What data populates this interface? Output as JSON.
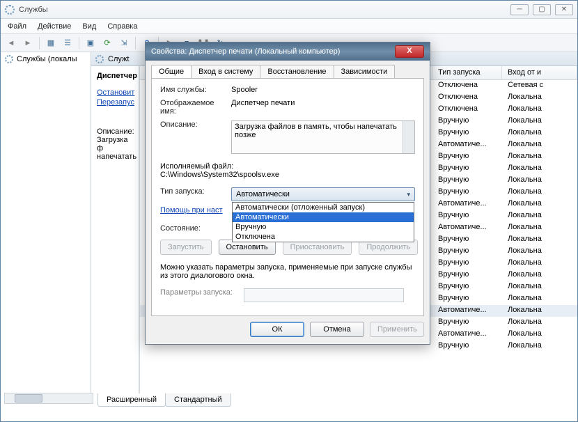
{
  "window": {
    "title": "Службы"
  },
  "menu": {
    "file": "Файл",
    "action": "Действие",
    "view": "Вид",
    "help": "Справка"
  },
  "tree": {
    "root": "Службы (локалы"
  },
  "panelHeader": "Служt",
  "detail": {
    "svcName": "Диспетчер",
    "stopLink": "Остановит",
    "restartLink": "Перезапус",
    "descLabel": "Описание:",
    "descText1": "Загрузка ф",
    "descText2": "напечатать"
  },
  "columns": {
    "startup": "Тип запуска",
    "logon": "Вход от и"
  },
  "rows": [
    {
      "startup": "Отключена",
      "logon": "Сетевая с"
    },
    {
      "startup": "Отключена",
      "logon": "Локальна"
    },
    {
      "startup": "Отключена",
      "logon": "Локальна"
    },
    {
      "startup": "Вручную",
      "logon": "Локальна"
    },
    {
      "startup": "Вручную",
      "logon": "Локальна"
    },
    {
      "startup": "Автоматиче...",
      "logon": "Локальна"
    },
    {
      "startup": "Вручную",
      "logon": "Локальна"
    },
    {
      "startup": "Вручную",
      "logon": "Локальна"
    },
    {
      "startup": "Вручную",
      "logon": "Локальна"
    },
    {
      "startup": "Вручную",
      "logon": "Локальна"
    },
    {
      "startup": "Автоматиче...",
      "logon": "Локальна"
    },
    {
      "startup": "Вручную",
      "logon": "Локальна"
    },
    {
      "startup": "Автоматиче...",
      "logon": "Локальна"
    },
    {
      "startup": "Вручную",
      "logon": "Локальна"
    },
    {
      "startup": "Вручную",
      "logon": "Локальна"
    },
    {
      "startup": "Вручную",
      "logon": "Локальна"
    },
    {
      "startup": "Вручную",
      "logon": "Локальна"
    },
    {
      "startup": "Вручную",
      "logon": "Локальна"
    },
    {
      "startup": "Вручную",
      "logon": "Локальна"
    },
    {
      "startup": "Автоматиче...",
      "logon": "Локальна"
    },
    {
      "startup": "Вручную",
      "logon": "Локальна"
    },
    {
      "startup": "Автоматиче...",
      "logon": "Локальна"
    },
    {
      "startup": "Вручную",
      "logon": "Локальна"
    }
  ],
  "tabs": {
    "extended": "Расширенный",
    "standard": "Стандартный"
  },
  "dialog": {
    "title": "Свойства: Диспетчер печати (Локальный компьютер)",
    "tabGeneral": "Общие",
    "tabLogon": "Вход в систему",
    "tabRecovery": "Восстановление",
    "tabDeps": "Зависимости",
    "lblServiceName": "Имя службы:",
    "valServiceName": "Spooler",
    "lblDisplayName": "Отображаемое имя:",
    "valDisplayName": "Диспетчер печати",
    "lblDescription": "Описание:",
    "valDescription": "Загрузка файлов в память, чтобы напечатать позже",
    "lblExePath": "Исполняемый файл:",
    "valExePath": "C:\\Windows\\System32\\spoolsv.exe",
    "lblStartupType": "Тип запуска:",
    "comboSelected": "Автоматически",
    "options": [
      "Автоматически (отложенный запуск)",
      "Автоматически",
      "Вручную",
      "Отключена"
    ],
    "helpLink": "Помощь при наст",
    "lblState": "Состояние:",
    "btnStart": "Запустить",
    "btnStop": "Остановить",
    "btnPause": "Приостановить",
    "btnResume": "Продолжить",
    "infoText": "Можно указать параметры запуска, применяемые при запуске службы из этого диалогового окна.",
    "lblParams": "Параметры запуска:",
    "btnOK": "ОК",
    "btnCancel": "Отмена",
    "btnApply": "Применить"
  }
}
